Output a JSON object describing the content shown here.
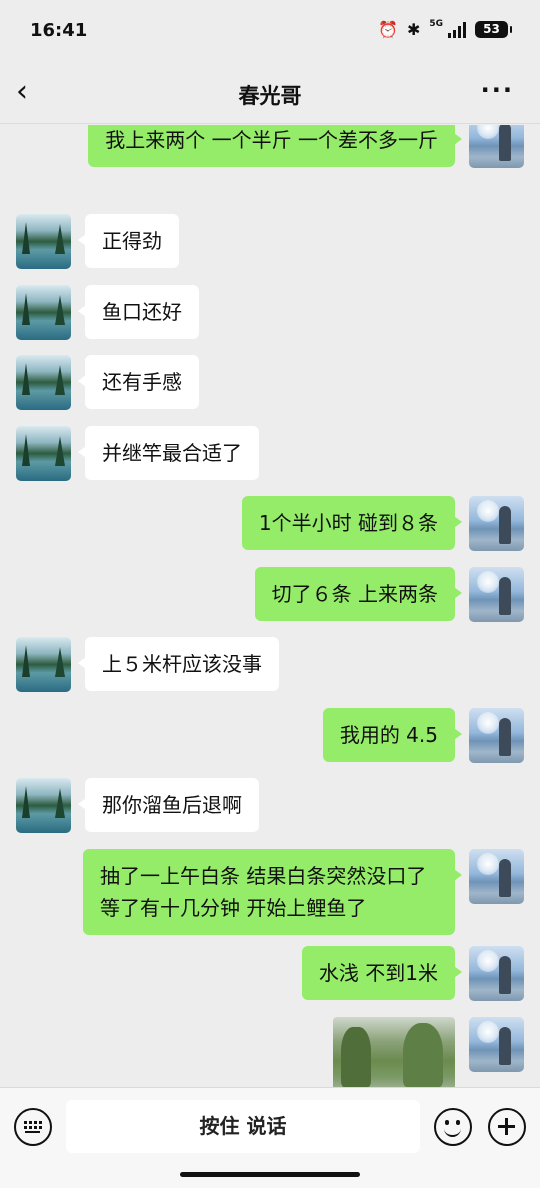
{
  "status_bar": {
    "time": "16:41",
    "network": "5G",
    "battery": "53"
  },
  "header": {
    "title": "春光哥"
  },
  "messages": [
    {
      "side": "right",
      "text": "我上来两个 一个半斤  一个差不多一斤"
    },
    {
      "side": "left",
      "text": "正得劲"
    },
    {
      "side": "left",
      "text": "鱼口还好"
    },
    {
      "side": "left",
      "text": "还有手感"
    },
    {
      "side": "left",
      "text": "并继竿最合适了"
    },
    {
      "side": "right",
      "text": "1个半小时  碰到８条"
    },
    {
      "side": "right",
      "text": "切了６条  上来两条"
    },
    {
      "side": "left",
      "text": "上５米杆应该没事"
    },
    {
      "side": "right",
      "text": "我用的 4.5"
    },
    {
      "side": "left",
      "text": "那你溜鱼后退啊"
    },
    {
      "side": "right",
      "text": "抽了一上午白条 结果白条突然没口了  等了有十几分钟  开始上鲤鱼了"
    },
    {
      "side": "right",
      "text": "水浅  不到1米"
    },
    {
      "side": "right",
      "type": "image"
    }
  ],
  "input_bar": {
    "hold_to_talk": "按住 说话"
  }
}
